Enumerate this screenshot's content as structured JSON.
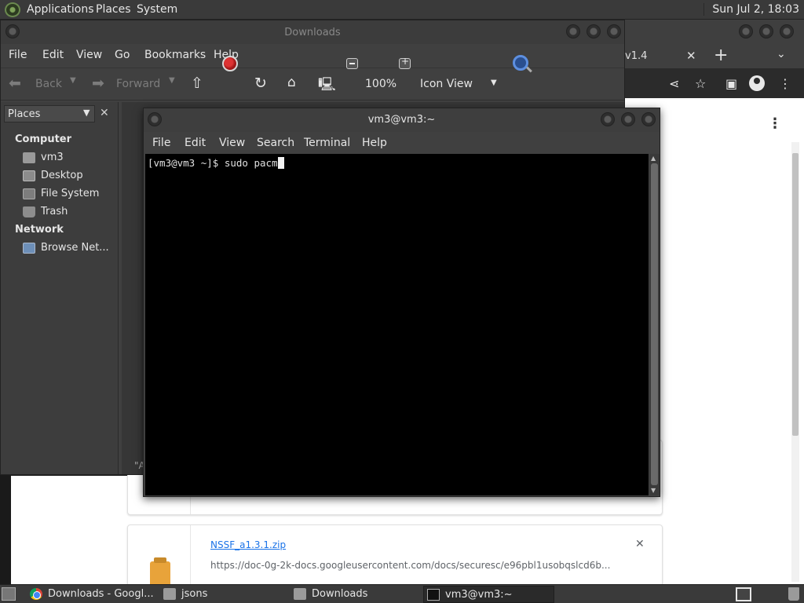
{
  "top_panel": {
    "menus": [
      "Applications",
      "Places",
      "System"
    ],
    "clock": "Sun Jul  2, 18:03"
  },
  "chrome": {
    "tab_fragment": "v1.4",
    "close_tab": "✕",
    "new_tab": "+",
    "tab_menu": "⌄",
    "share": "⋖",
    "star": "☆",
    "sidepanel": "▣",
    "menu": "⋮",
    "page_menu": "⋮"
  },
  "downloads_page": {
    "file_name": "NSSF_a1.3.1.zip",
    "url": "https://doc-0g-2k-docs.googleusercontent.com/docs/securesc/e96pbl1usobqslcd6b...",
    "remove": "✕"
  },
  "file_manager": {
    "title": "Downloads",
    "menus": [
      "File",
      "Edit",
      "View",
      "Go",
      "Bookmarks",
      "Help"
    ],
    "toolbar": {
      "back": "Back",
      "forward": "Forward",
      "zoom": "100%",
      "view_mode": "Icon View"
    },
    "sidebar": {
      "header": "Places",
      "close": "✕",
      "groups": [
        {
          "label": "Computer",
          "items": [
            "vm3",
            "Desktop",
            "File System",
            "Trash"
          ]
        },
        {
          "label": "Network",
          "items": [
            "Browse Net..."
          ]
        }
      ]
    },
    "status_fragment": "\"A"
  },
  "terminal": {
    "title": "vm3@vm3:~",
    "menus": [
      "File",
      "Edit",
      "View",
      "Search",
      "Terminal",
      "Help"
    ],
    "prompt_line": "[vm3@vm3 ~]$ sudo pacm"
  },
  "taskbar": {
    "tasks": [
      {
        "label": "Downloads - Googl...",
        "icon": "chrome-icon"
      },
      {
        "label": "jsons",
        "icon": "folder-icon"
      },
      {
        "label": "Downloads",
        "icon": "folder-icon"
      },
      {
        "label": "vm3@vm3:~",
        "icon": "terminal-icon",
        "active": true
      }
    ]
  },
  "colors": {
    "accent_link": "#1a73e8",
    "stop_red": "#d33333",
    "panel_bg": "#3a3a3a"
  }
}
